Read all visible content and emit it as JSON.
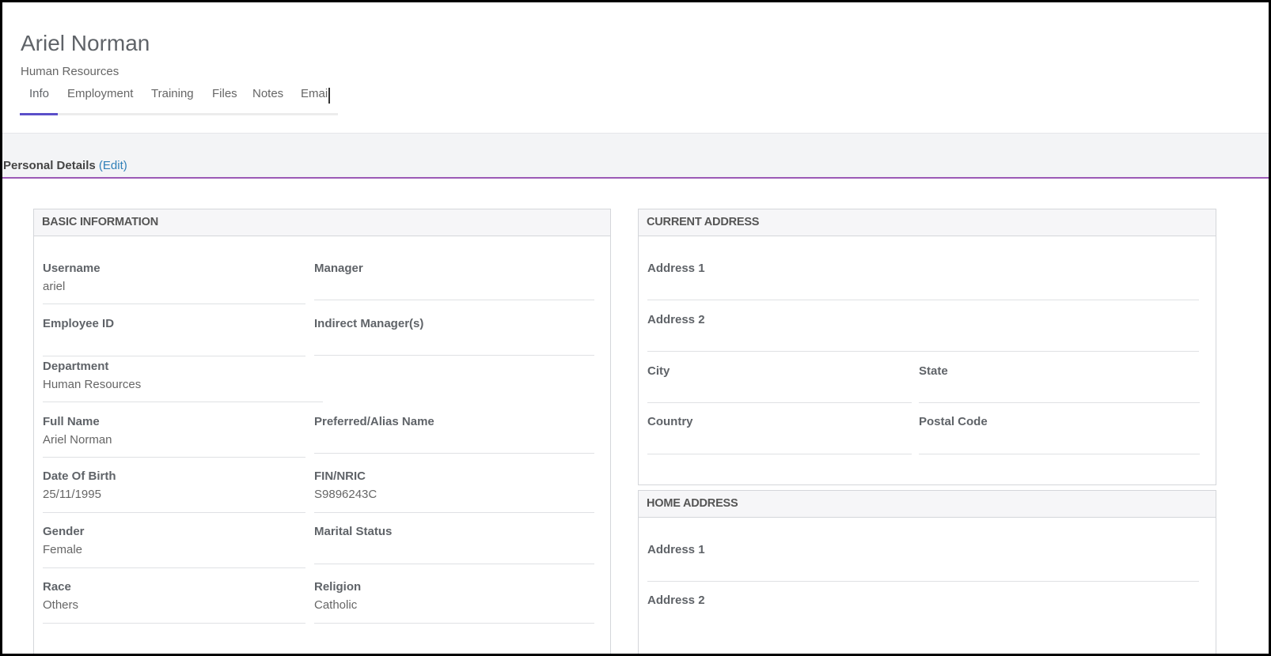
{
  "header": {
    "employee_name": "Ariel Norman",
    "department": "Human Resources"
  },
  "tabs": [
    {
      "label": "Info",
      "active": true
    },
    {
      "label": "Employment",
      "active": false
    },
    {
      "label": "Training",
      "active": false
    },
    {
      "label": "Files",
      "active": false
    },
    {
      "label": "Notes",
      "active": false
    },
    {
      "label": "Email",
      "active": false
    }
  ],
  "section": {
    "title": "Personal Details",
    "edit_label": "(Edit)"
  },
  "basic_information": {
    "title": "BASIC INFORMATION",
    "fields": {
      "username": {
        "label": "Username",
        "value": "ariel"
      },
      "manager": {
        "label": "Manager",
        "value": ""
      },
      "employee_id": {
        "label": "Employee ID",
        "value": ""
      },
      "indirect_manager": {
        "label": "Indirect Manager(s)",
        "value": ""
      },
      "department": {
        "label": "Department",
        "value": "Human Resources"
      },
      "full_name": {
        "label": "Full Name",
        "value": "Ariel Norman"
      },
      "preferred_name": {
        "label": "Preferred/Alias Name",
        "value": ""
      },
      "date_of_birth": {
        "label": "Date Of Birth",
        "value": "25/11/1995"
      },
      "fin_nric": {
        "label": "FIN/NRIC",
        "value": "S9896243C"
      },
      "gender": {
        "label": "Gender",
        "value": "Female"
      },
      "marital_status": {
        "label": "Marital Status",
        "value": ""
      },
      "race": {
        "label": "Race",
        "value": "Others"
      },
      "religion": {
        "label": "Religion",
        "value": "Catholic"
      }
    }
  },
  "current_address": {
    "title": "CURRENT ADDRESS",
    "fields": {
      "address1": {
        "label": "Address 1",
        "value": ""
      },
      "address2": {
        "label": "Address 2",
        "value": ""
      },
      "city": {
        "label": "City",
        "value": ""
      },
      "state": {
        "label": "State",
        "value": ""
      },
      "country": {
        "label": "Country",
        "value": ""
      },
      "postal_code": {
        "label": "Postal Code",
        "value": ""
      }
    }
  },
  "home_address": {
    "title": "HOME ADDRESS",
    "fields": {
      "address1": {
        "label": "Address 1",
        "value": ""
      },
      "address2": {
        "label": "Address 2",
        "value": ""
      }
    }
  },
  "colors": {
    "accent": "#5b4fc9",
    "section_border": "#9b59b6",
    "edit_link": "#2f7fb8"
  }
}
